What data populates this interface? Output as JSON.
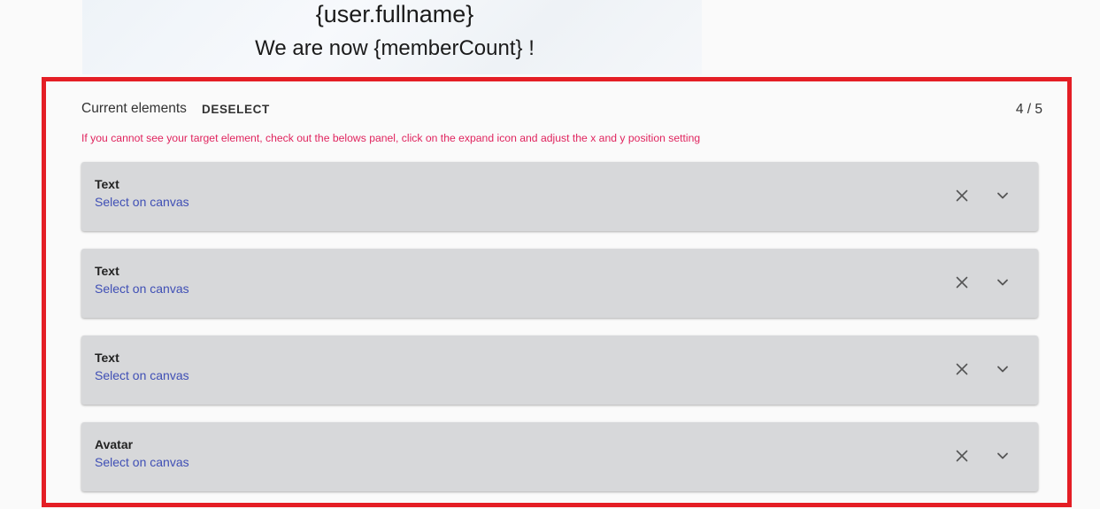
{
  "preview": {
    "fullname": "{user.fullname}",
    "member_count_text": "We are now {memberCount} !"
  },
  "panel": {
    "title": "Current elements",
    "deselect_label": "DESELECT",
    "count": "4 / 5",
    "hint": "If you cannot see your target element, check out the belows panel, click on the expand icon and adjust the x and y position setting",
    "items": [
      {
        "title": "Text",
        "link": "Select on canvas",
        "icons": [
          "close-icon",
          "chevron-down-icon"
        ]
      },
      {
        "title": "Text",
        "link": "Select on canvas",
        "icons": [
          "close-icon",
          "chevron-down-icon"
        ]
      },
      {
        "title": "Text",
        "link": "Select on canvas",
        "icons": [
          "close-icon",
          "chevron-down-icon"
        ]
      },
      {
        "title": "Avatar",
        "link": "Select on canvas",
        "icons": [
          "close-icon",
          "chevron-down-icon"
        ]
      }
    ]
  },
  "colors": {
    "highlight_border": "#e41e25",
    "hint_text": "#e0245e",
    "link": "#3f4fb5",
    "item_bg": "#d7d8da"
  }
}
